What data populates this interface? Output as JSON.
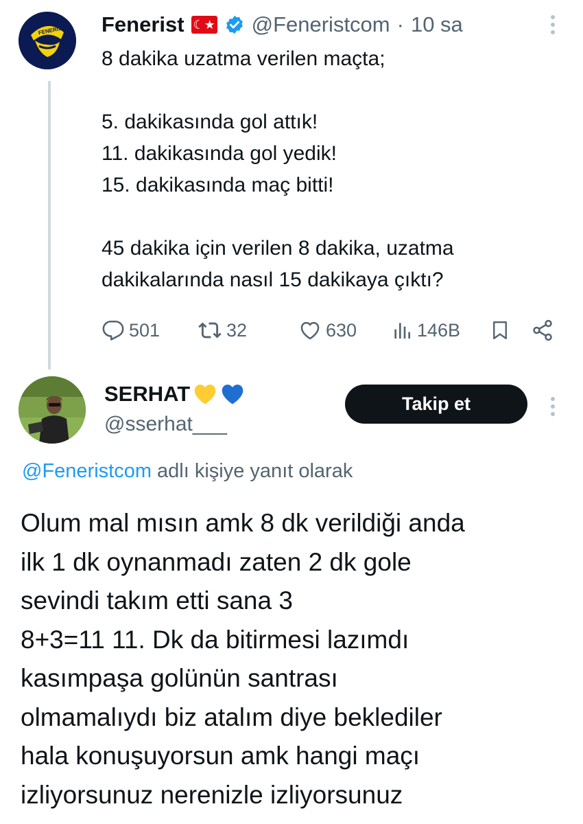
{
  "tweet": {
    "display_name": "Fenerist",
    "flag": "🇹🇷",
    "handle": "@Feneristcom",
    "separator": "·",
    "time": "10 sa",
    "text_lines": [
      "8 dakika uzatma verilen maçta;",
      "",
      "5. dakikasında gol attık!",
      "11. dakikasında gol yedik!",
      "15. dakikasında maç bitti!",
      "",
      "45 dakika için verilen 8 dakika, uzatma",
      "dakikalarında nasıl 15 dakikaya çıktı?"
    ],
    "stats": {
      "replies": "501",
      "retweets": "32",
      "likes": "630",
      "views": "146B"
    },
    "avatar_text": "FENERIST"
  },
  "reply": {
    "display_name": "SERHAT",
    "handle": "@sserhat___",
    "follow_label": "Takip et",
    "replying_mention": "@Feneristcom",
    "replying_suffix": "adlı kişiye yanıt olarak",
    "text_lines": [
      "Olum mal mısın amk 8 dk verildiği anda",
      "ilk 1 dk oynanmadı zaten 2 dk gole",
      "sevindi takım etti sana 3",
      "8+3=11 11. Dk da bitirmesi lazımdı",
      "kasımpaşa golünün santrası",
      "olmamalıydı biz atalım diye beklediler",
      "hala konuşuyorsun amk hangi maçı",
      "izliyorsunuz nerenizle izliyorsunuz"
    ]
  },
  "colors": {
    "text": "#0f1419",
    "muted": "#536471",
    "link": "#1d9bf0",
    "verified": "#1d9bf0",
    "heart_yellow": "#ffcc33",
    "heart_blue": "#1f6fd1",
    "follow_bg": "#0f1419",
    "thread_line": "#cfd9de"
  },
  "icons": [
    "more-icon",
    "verified-icon",
    "reply-icon",
    "retweet-icon",
    "like-icon",
    "views-icon",
    "bookmark-icon",
    "share-icon",
    "yellow-heart-icon",
    "blue-heart-icon"
  ]
}
